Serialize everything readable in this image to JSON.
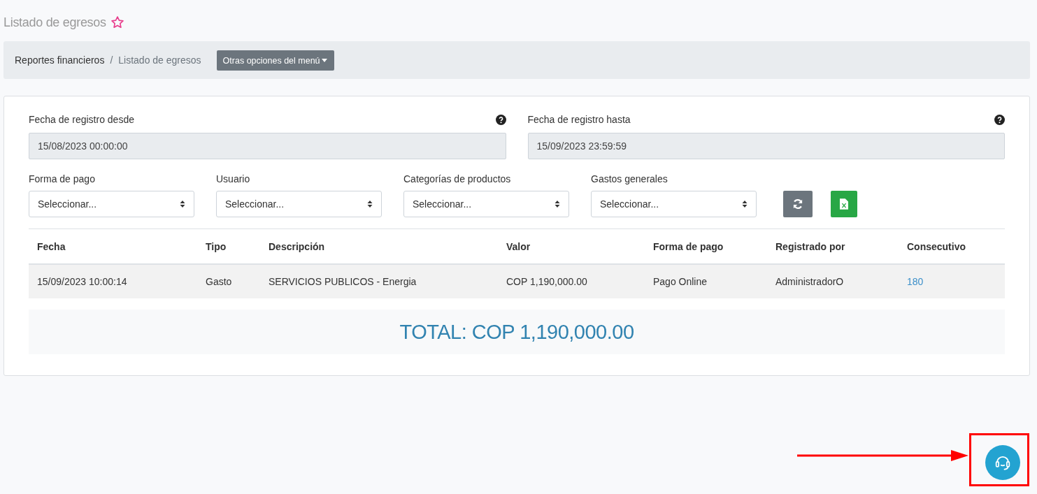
{
  "page_title": "Listado de egresos",
  "breadcrumb": [
    "Reportes financieros",
    "Listado de egresos"
  ],
  "breadcrumb_separator": "/",
  "menu_button": "Otras opciones del menú",
  "date_fields": [
    {
      "label": "Fecha de registro desde",
      "value": "15/08/2023 00:00:00"
    },
    {
      "label": "Fecha de registro hasta",
      "value": "15/09/2023 23:59:59"
    }
  ],
  "selects": [
    {
      "label": "Forma de pago",
      "placeholder": "Seleccionar..."
    },
    {
      "label": "Usuario",
      "placeholder": "Seleccionar..."
    },
    {
      "label": "Categorías de productos",
      "placeholder": "Seleccionar..."
    },
    {
      "label": "Gastos generales",
      "placeholder": "Seleccionar..."
    }
  ],
  "table": {
    "columns": [
      "Fecha",
      "Tipo",
      "Descripción",
      "Valor",
      "Forma de pago",
      "Registrado por",
      "Consecutivo"
    ],
    "rows": [
      [
        "15/09/2023 10:00:14",
        "Gasto",
        "SERVICIOS PUBLICOS - Energia",
        "COP 1,190,000.00",
        "Pago Online",
        "AdministradorO",
        "180"
      ]
    ]
  },
  "total": "TOTAL: COP 1,190,000.00"
}
